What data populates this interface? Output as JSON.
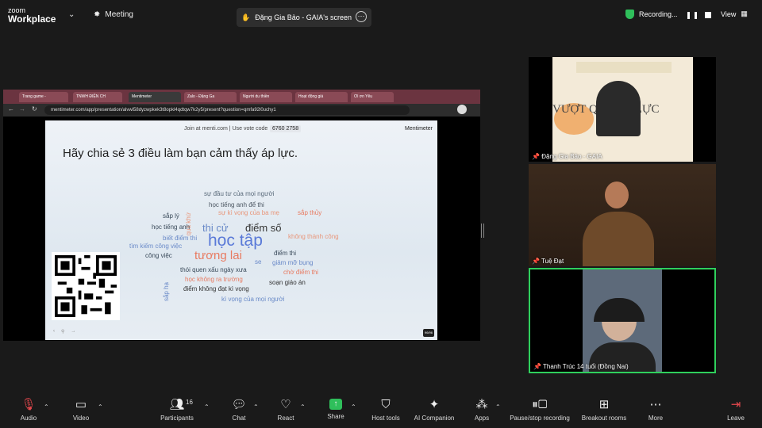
{
  "app": {
    "logo_line1": "zoom",
    "logo_line2": "Workplace",
    "meeting_tab": "Meeting",
    "screen_title": "Đặng Gia Bảo - GAIA's screen",
    "recording": "Recording...",
    "view": "View"
  },
  "browser": {
    "tabs": [
      "Trang game -",
      "TNWH ĐIỆN CH",
      "Mentimeter",
      "Zalo - Đặng Ga",
      "Người du thiền",
      "Hoạt động giá",
      "Ơi ơn Yêu"
    ],
    "url": "mentimeter.com/app/presentation/alvwi58dyzwpkek3t8opkl4qdtqw7k2y5/present?question=qmfa92l0uchy1"
  },
  "slide": {
    "join_text": "Join at menti.com | Use vote code",
    "vote_code": "6760 2758",
    "brand": "Mentimeter",
    "question": "Hãy chia sẻ 3 điều làm bạn cảm thấy áp lực.",
    "badge": "96/96",
    "words": [
      {
        "text": "sự đầu tư của mọi người",
        "color": "#5a6a7a",
        "size": 8
      },
      {
        "text": "học tiếng anh để thi",
        "color": "#4a5560",
        "size": 8
      },
      {
        "text": "sắp lý",
        "color": "#3a4a5a",
        "size": 8
      },
      {
        "text": "sự kì vọng của ba mẹ",
        "color": "#e8977c",
        "size": 8
      },
      {
        "text": "sắp thủy",
        "color": "#e87a60",
        "size": 8
      },
      {
        "text": "quá khứ",
        "color": "#e8977c",
        "size": 8
      },
      {
        "text": "thi cử",
        "color": "#6a8ac8",
        "size": 13
      },
      {
        "text": "điểm số",
        "color": "#333333",
        "size": 13
      },
      {
        "text": "học tiếng anh",
        "color": "#3a4a5a",
        "size": 8
      },
      {
        "text": "biết điểm thi",
        "color": "#6a8ac8",
        "size": 8
      },
      {
        "text": "không thành công",
        "color": "#e8977c",
        "size": 8
      },
      {
        "text": "học tập",
        "color": "#5a7ad8",
        "size": 21
      },
      {
        "text": "tìm kiếm công việc",
        "color": "#6a8ac8",
        "size": 8
      },
      {
        "text": "công việc",
        "color": "#3a4a5a",
        "size": 8
      },
      {
        "text": "tương lai",
        "color": "#e87a60",
        "size": 15
      },
      {
        "text": "điểm thi",
        "color": "#3a4a5a",
        "size": 8
      },
      {
        "text": "se",
        "color": "#6a8ac8",
        "size": 8
      },
      {
        "text": "giảm mỡ bụng",
        "color": "#6a8ac8",
        "size": 8
      },
      {
        "text": "thói quen xấu ngày xưa",
        "color": "#3a4a5a",
        "size": 8
      },
      {
        "text": "chờ điểm thi",
        "color": "#e87a60",
        "size": 8
      },
      {
        "text": "học không ra trường",
        "color": "#e87a60",
        "size": 8
      },
      {
        "text": "sắp hạ",
        "color": "#6a8ac8",
        "size": 8
      },
      {
        "text": "soạn giáo án",
        "color": "#333333",
        "size": 8
      },
      {
        "text": "điểm không đạt kì vọng",
        "color": "#333333",
        "size": 8
      },
      {
        "text": "kì vọng của mọi người",
        "color": "#6a8ac8",
        "size": 8
      }
    ]
  },
  "participants_tiles": [
    {
      "name": "Đặng Gia Bảo - GAIA",
      "slide_title": "VƯỢT QUA ÁP LỰC"
    },
    {
      "name": "Tuệ Đạt"
    },
    {
      "name": "Thanh Trúc 14 tuổi (Đồng Nai)"
    }
  ],
  "toolbar": {
    "audio": "Audio",
    "video": "Video",
    "participants": "Participants",
    "participants_count": "16",
    "chat": "Chat",
    "react": "React",
    "share": "Share",
    "host_tools": "Host tools",
    "ai_companion": "AI Companion",
    "apps": "Apps",
    "pause_recording": "Pause/stop recording",
    "breakout": "Breakout rooms",
    "more": "More",
    "leave": "Leave"
  }
}
